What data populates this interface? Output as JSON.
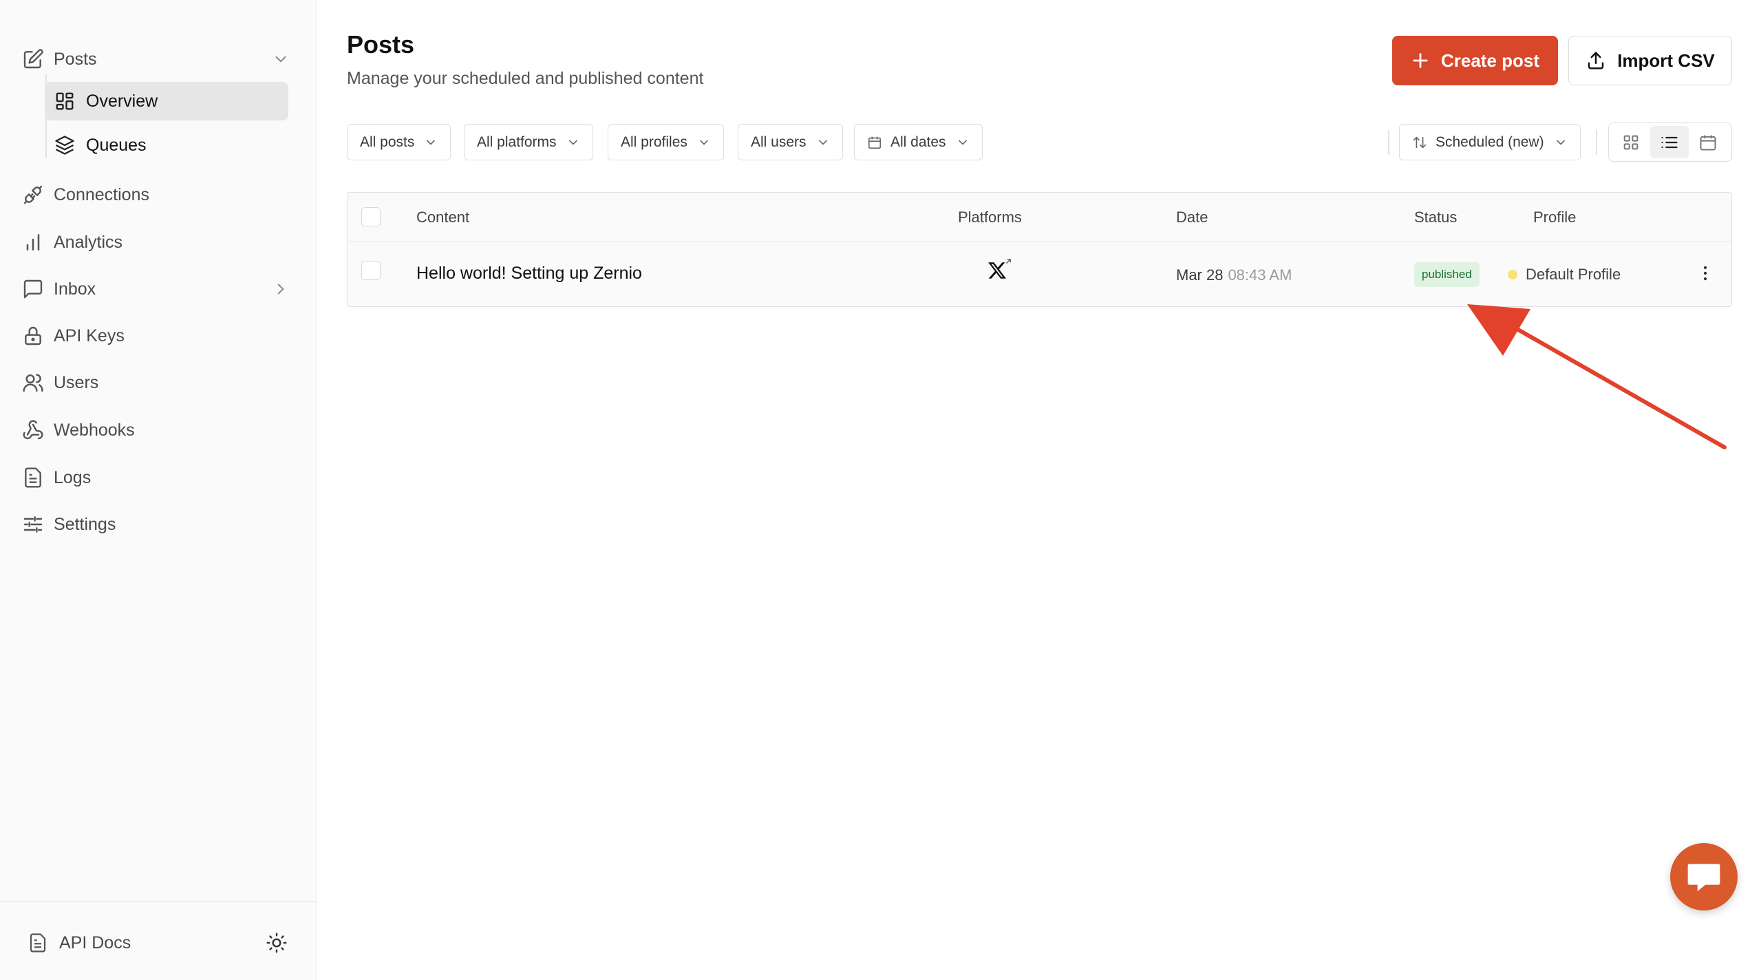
{
  "sidebar": {
    "items": [
      {
        "label": "Posts",
        "icon": "edit-square-icon"
      },
      {
        "label": "Overview",
        "icon": "dashboard-grid-icon"
      },
      {
        "label": "Queues",
        "icon": "layers-icon"
      },
      {
        "label": "Connections",
        "icon": "plug-icon"
      },
      {
        "label": "Analytics",
        "icon": "bar-chart-icon"
      },
      {
        "label": "Inbox",
        "icon": "message-square-icon"
      },
      {
        "label": "API Keys",
        "icon": "lock-icon"
      },
      {
        "label": "Users",
        "icon": "users-icon"
      },
      {
        "label": "Webhooks",
        "icon": "webhook-icon"
      },
      {
        "label": "Logs",
        "icon": "file-text-icon"
      },
      {
        "label": "Settings",
        "icon": "sliders-icon"
      }
    ],
    "footer": {
      "api_docs": "API Docs",
      "theme_icon": "sun-icon"
    }
  },
  "header": {
    "title": "Posts",
    "subtitle": "Manage your scheduled and published content",
    "create_label": "Create post",
    "import_label": "Import CSV"
  },
  "filters": {
    "posts": "All posts",
    "platforms": "All platforms",
    "profiles": "All profiles",
    "users": "All users",
    "dates": "All dates",
    "sort": "Scheduled (new)"
  },
  "view_modes": [
    "grid",
    "list",
    "calendar"
  ],
  "active_view": "list",
  "table": {
    "columns": [
      "Content",
      "Platforms",
      "Date",
      "Status",
      "Profile"
    ],
    "rows": [
      {
        "content": "Hello world! Setting up Zernio",
        "platform": "x-logo-icon",
        "date": "Mar 28",
        "time": "08:43 AM",
        "status": "published",
        "profile": "Default Profile"
      }
    ]
  },
  "colors": {
    "accent": "#d9472b",
    "status_published_bg": "#dff3e2",
    "status_published_text": "#1d6b2e",
    "profile_dot": "#f7e27a",
    "annotation_arrow": "#e2412b",
    "chat_button": "#d95a2b"
  }
}
